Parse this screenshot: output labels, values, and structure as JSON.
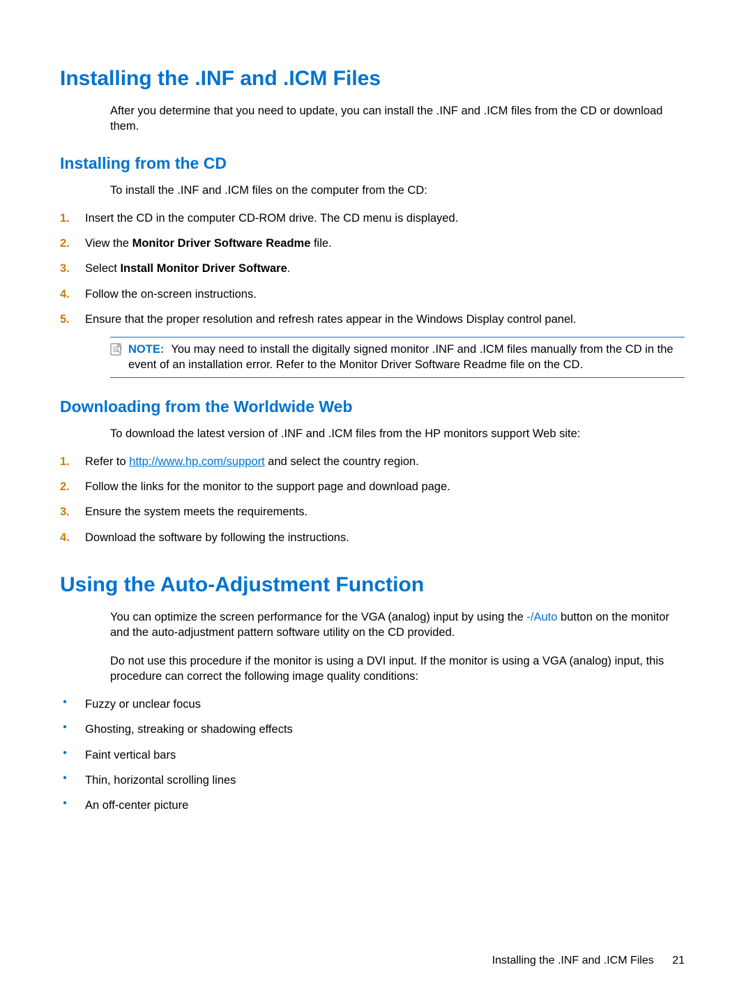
{
  "section1": {
    "title": "Installing the .INF and .ICM Files",
    "intro": "After you determine that you need to update, you can install the .INF and .ICM files from the CD or download them.",
    "sub1": {
      "title": "Installing from the CD",
      "intro": "To install the .INF and .ICM files on the computer from the CD:",
      "steps": {
        "n1": "1.",
        "s1": "Insert the CD in the computer CD-ROM drive. The CD menu is displayed.",
        "n2": "2.",
        "s2a": "View the ",
        "s2b": "Monitor Driver Software Readme",
        "s2c": " file.",
        "n3": "3.",
        "s3a": "Select ",
        "s3b": "Install Monitor Driver Software",
        "s3c": ".",
        "n4": "4.",
        "s4": "Follow the on-screen instructions.",
        "n5": "5.",
        "s5": "Ensure that the proper resolution and refresh rates appear in the Windows Display control panel."
      },
      "note_label": "NOTE:",
      "note_text": "You may need to install the digitally signed monitor .INF and .ICM files manually from the CD in the event of an installation error. Refer to the Monitor Driver Software Readme file on the CD."
    },
    "sub2": {
      "title": "Downloading from the Worldwide Web",
      "intro": "To download the latest version of .INF and .ICM files from the HP monitors support Web site:",
      "steps": {
        "n1": "1.",
        "s1a": "Refer to ",
        "s1b": "http://www.hp.com/support",
        "s1c": " and select the country region.",
        "n2": "2.",
        "s2": "Follow the links for the monitor to the support page and download page.",
        "n3": "3.",
        "s3": "Ensure the system meets the requirements.",
        "n4": "4.",
        "s4": "Download the software by following the instructions."
      }
    }
  },
  "section2": {
    "title": "Using the Auto-Adjustment Function",
    "p1a": "You can optimize the screen performance for the VGA (analog) input by using the ",
    "p1b": "-/Auto",
    "p1c": " button on the monitor and the auto-adjustment pattern software utility on the CD provided.",
    "p2": "Do not use this procedure if the monitor is using a DVI input. If the monitor is using a VGA (analog) input, this procedure can correct the following image quality conditions:",
    "bullets": {
      "b1": "Fuzzy or unclear focus",
      "b2": "Ghosting, streaking or shadowing effects",
      "b3": "Faint vertical bars",
      "b4": "Thin, horizontal scrolling lines",
      "b5": "An off-center picture"
    }
  },
  "footer": {
    "title": "Installing the .INF and .ICM Files",
    "page": "21"
  }
}
